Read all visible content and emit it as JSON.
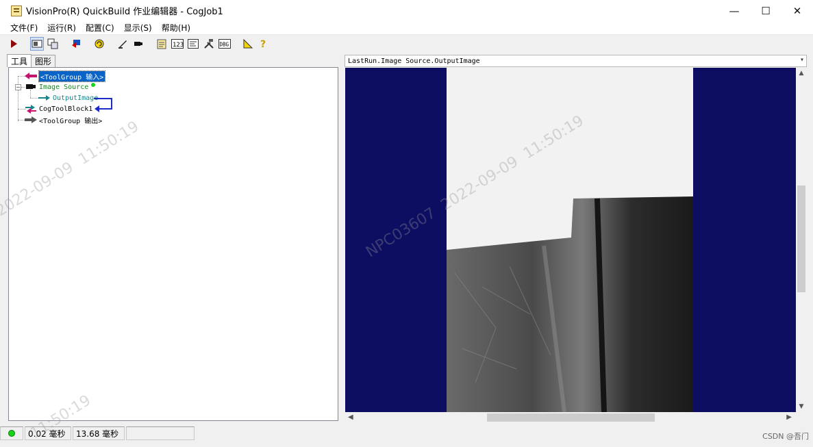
{
  "window": {
    "title": "VisionPro(R) QuickBuild 作业编辑器 - CogJob1",
    "controls": {
      "minimize": "—",
      "maximize": "☐",
      "close": "✕"
    }
  },
  "menu": [
    {
      "label": "文件(F)"
    },
    {
      "label": "运行(R)"
    },
    {
      "label": "配置(C)"
    },
    {
      "label": "显示(S)"
    },
    {
      "label": "帮助(H)"
    }
  ],
  "toolbar": {
    "icons": [
      "run-once-icon",
      "show-image-icon",
      "float-window-icon",
      "reset-icon",
      "run-continuous-icon",
      "pen-icon",
      "camera-icon",
      "checklist-icon",
      "counter-icon",
      "terminal-icon",
      "tools-icon",
      "dbg-icon",
      "ruler-icon",
      "help-icon"
    ],
    "counter_text": "123",
    "dbg_text": "DBG"
  },
  "tabs": [
    {
      "label": "工具",
      "active": true
    },
    {
      "label": "图形",
      "active": false
    }
  ],
  "tree": {
    "input": "<ToolGroup 输入>",
    "image_source": "Image Source",
    "output_image": "OutputImage",
    "tool_block": "CogToolBlock1",
    "output": "<ToolGroup 输出>"
  },
  "image_panel": {
    "selector": "LastRun.Image Source.OutputImage"
  },
  "status": {
    "led_color": "#18d418",
    "time1": "0.02 毫秒",
    "time2": "13.68 毫秒"
  },
  "watermark": {
    "line1": "NPC03607",
    "line2": "2022-09-09",
    "line3": "11:50:19"
  },
  "credit": "CSDN @吾门"
}
